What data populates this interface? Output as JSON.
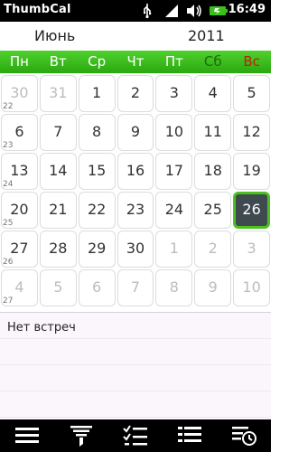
{
  "status_bar": {
    "app_title": "ThumbCal",
    "time": "16:49",
    "icons": [
      "usb-icon",
      "signal-icon",
      "volume-icon",
      "battery-icon"
    ]
  },
  "header": {
    "month": "Июнь",
    "year": "2011"
  },
  "weekdays": [
    "Пн",
    "Вт",
    "Ср",
    "Чт",
    "Пт",
    "Сб",
    "Вс"
  ],
  "weeks": [
    {
      "week_no": "22",
      "days": [
        {
          "d": "30",
          "other": true
        },
        {
          "d": "31",
          "other": true
        },
        {
          "d": "1"
        },
        {
          "d": "2"
        },
        {
          "d": "3"
        },
        {
          "d": "4"
        },
        {
          "d": "5"
        }
      ]
    },
    {
      "week_no": "23",
      "days": [
        {
          "d": "6"
        },
        {
          "d": "7"
        },
        {
          "d": "8"
        },
        {
          "d": "9"
        },
        {
          "d": "10"
        },
        {
          "d": "11"
        },
        {
          "d": "12"
        }
      ]
    },
    {
      "week_no": "24",
      "days": [
        {
          "d": "13"
        },
        {
          "d": "14"
        },
        {
          "d": "15"
        },
        {
          "d": "16"
        },
        {
          "d": "17"
        },
        {
          "d": "18"
        },
        {
          "d": "19"
        }
      ]
    },
    {
      "week_no": "25",
      "days": [
        {
          "d": "20"
        },
        {
          "d": "21"
        },
        {
          "d": "22"
        },
        {
          "d": "23"
        },
        {
          "d": "24"
        },
        {
          "d": "25"
        },
        {
          "d": "26",
          "today": true
        }
      ]
    },
    {
      "week_no": "26",
      "days": [
        {
          "d": "27"
        },
        {
          "d": "28"
        },
        {
          "d": "29"
        },
        {
          "d": "30"
        },
        {
          "d": "1",
          "other": true
        },
        {
          "d": "2",
          "other": true
        },
        {
          "d": "3",
          "other": true
        }
      ]
    },
    {
      "week_no": "27",
      "days": [
        {
          "d": "4",
          "other": true
        },
        {
          "d": "5",
          "other": true
        },
        {
          "d": "6",
          "other": true
        },
        {
          "d": "7",
          "other": true
        },
        {
          "d": "8",
          "other": true
        },
        {
          "d": "9",
          "other": true
        },
        {
          "d": "10",
          "other": true
        }
      ]
    }
  ],
  "events": {
    "empty_text": "Нет встреч"
  },
  "toolbar": {
    "buttons": [
      "menu-icon",
      "filter-icon",
      "tasks-icon",
      "list-icon",
      "history-icon"
    ]
  },
  "colors": {
    "weekday_bar": "#3bbf1c",
    "saturday": "#1b6b12",
    "sunday": "#c1200f",
    "today_bg": "#3e4a50",
    "today_border": "#4ac11d"
  }
}
